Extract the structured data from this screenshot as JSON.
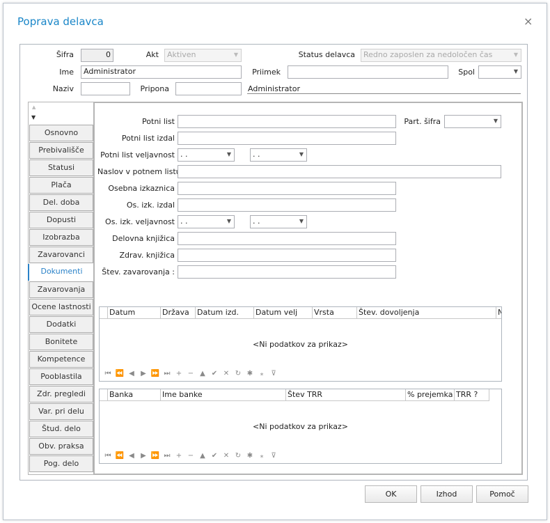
{
  "window": {
    "title": "Poprava delavca",
    "close_icon": "×"
  },
  "header": {
    "sifra_label": "Šifra",
    "sifra_value": "0",
    "akt_label": "Akt",
    "akt_value": "Aktiven",
    "status_label": "Status delavca",
    "status_value": "Redno zaposlen za nedoločen čas",
    "ime_label": "Ime",
    "ime_value": "Administrator",
    "priimek_label": "Priimek",
    "priimek_value": "",
    "spol_label": "Spol",
    "spol_value": "",
    "naziv_label": "Naziv",
    "naziv_value": "",
    "pripona_label": "Pripona",
    "pripona_value": "",
    "full_name": "Administrator"
  },
  "tabs": [
    "Osnovno",
    "Prebivališče",
    "Statusi",
    "Plača",
    "Del. doba",
    "Dopusti",
    "Izobrazba",
    "Zavarovanci",
    "Dokumenti",
    "Zavarovanja",
    "Ocene lastnosti",
    "Dodatki",
    "Bonitete",
    "Kompetence",
    "Pooblastila",
    "Zdr. pregledi",
    "Var. pri delu",
    "Štud. delo",
    "Obv. praksa",
    "Pog. delo"
  ],
  "active_tab": "Dokumenti",
  "form": {
    "potni_list": "Potni list",
    "part_sifra": "Part. šifra",
    "potni_list_izdal": "Potni list izdal",
    "potni_list_veljavnost": "Potni list veljavnost",
    "naslov": "Naslov v potnem listu",
    "osebna": "Osebna izkaznica",
    "os_izk_izdal": "Os. izk. izdal",
    "os_izk_veljavnost": "Os. izk. veljavnost",
    "delovna": "Delovna knjižica",
    "zdrav": "Zdrav. knjižica",
    "stev_zav": "Štev. zavarovanja :",
    "date_placeholder": " .  ."
  },
  "grid1": {
    "columns": [
      "Datum",
      "Država",
      "Datum izd.",
      "Datum velj",
      "Vrsta",
      "Štev. dovoljenja",
      "N"
    ],
    "empty_text": "<Ni podatkov za prikaz>"
  },
  "grid2": {
    "columns": [
      "Banka",
      "Ime banke",
      "Štev TRR",
      "% prejemka",
      "TRR ?"
    ],
    "empty_text": "<Ni podatkov za prikaz>"
  },
  "navigator": [
    "⏮",
    "⏪",
    "◀",
    "▶",
    "⏩",
    "⏭",
    "+",
    "−",
    "▲",
    "✔",
    "✕",
    "↻",
    "✱",
    "⁎",
    "⊽"
  ],
  "buttons": {
    "ok": "OK",
    "izhod": "Izhod",
    "pomoc": "Pomoč"
  }
}
